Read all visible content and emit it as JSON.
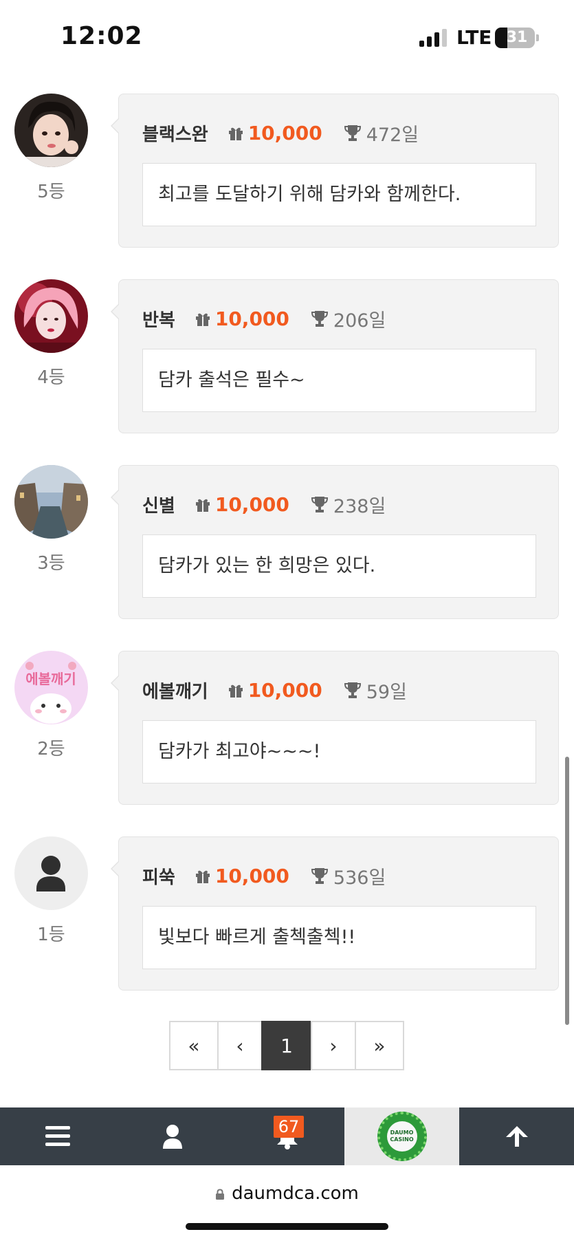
{
  "status_bar": {
    "time": "12:02",
    "network": "LTE",
    "battery": "31"
  },
  "entries": [
    {
      "rank": "5등",
      "nickname": "블랙스완",
      "points": "10,000",
      "days": "472일",
      "message": "최고를 도달하기 위해 담카와 함께한다.",
      "avatar": "photo-girl-black-hair"
    },
    {
      "rank": "4등",
      "nickname": "반복",
      "points": "10,000",
      "days": "206일",
      "message": "담카 출석은 필수~",
      "avatar": "photo-girl-pink-hair"
    },
    {
      "rank": "3등",
      "nickname": "신별",
      "points": "10,000",
      "days": "238일",
      "message": "담카가 있는 한 희망은 있다.",
      "avatar": "photo-canal-city"
    },
    {
      "rank": "2등",
      "nickname": "에볼깨기",
      "points": "10,000",
      "days": "59일",
      "message": "담카가 최고야~~~!",
      "avatar": "cartoon-cat-pink",
      "avatar_text": "에볼깨기"
    },
    {
      "rank": "1등",
      "nickname": "피쑥",
      "points": "10,000",
      "days": "536일",
      "message": "빛보다 빠르게 출첵출첵!!",
      "avatar": "default-user"
    }
  ],
  "pagination": {
    "first": "«",
    "prev": "‹",
    "current": "1",
    "next": "›",
    "last": "»"
  },
  "bottom_nav": {
    "notification_count": "67",
    "logo_text_1": "DAUMO",
    "logo_text_2": "CASINO"
  },
  "address_bar": {
    "url": "daumdca.com"
  },
  "colors": {
    "accent": "#f15a1f",
    "nav_bg": "#373f47",
    "card_bg": "#f3f3f3"
  }
}
